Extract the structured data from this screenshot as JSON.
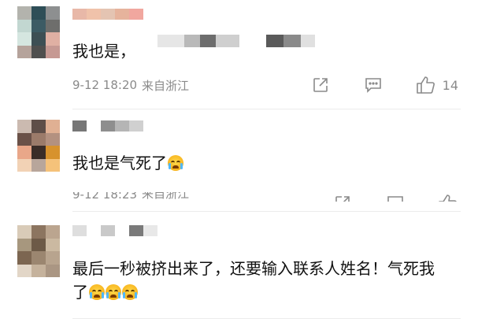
{
  "comments": [
    {
      "text_prefix": "我也是，",
      "time": "9-12 18:20",
      "location": "来自浙江",
      "likes": "14",
      "avatar_colors": [
        "#b3b3ad",
        "#2e4e57",
        "#8d8f90",
        "#c2d7d1",
        "#3c5b64",
        "#6e6e6c",
        "#d5e6e0",
        "#3d4f54",
        "#e0b0a3",
        "#b5a39b",
        "#4f4f4e",
        "#c69993"
      ],
      "name_colors": [
        "#e8b8a8",
        "#f0c2aa",
        "#e4c4b2",
        "#e6b39c",
        "#f1a79f"
      ],
      "mask_colors": [
        "#e6e6e6",
        "#b9b9b9",
        "#6d6d6d",
        "#cfcfcf",
        "#ffffff",
        "#5a5a5a",
        "#8a8a8a",
        "#e0e0e0"
      ]
    },
    {
      "text": "我也是气死了",
      "time_clipped": "9-12 18:23",
      "location_clipped": "来自浙江",
      "avatar_colors": [
        "#cbbab0",
        "#5e4e48",
        "#e0b093",
        "#6a5148",
        "#9b7b6a",
        "#b39180",
        "#e9a789",
        "#3a2d28",
        "#d7922d",
        "#f2d2b5",
        "#b8a69b",
        "#f5c27a"
      ],
      "name_colors": [
        "#777777",
        "#ffffff",
        "#8e8e8e",
        "#b5b5b5",
        "#d0d0d0"
      ]
    },
    {
      "text": "最后一秒被挤出来了，还要输入联系人姓名！气死我了",
      "avatar_colors": [
        "#d9cbb8",
        "#8c7560",
        "#bba58f",
        "#a7977e",
        "#6d5a47",
        "#cbb9a1",
        "#7c6651",
        "#9b8670",
        "#b8a48e",
        "#e2d6c7",
        "#c5b29c",
        "#aa9683"
      ],
      "name_colors": [
        "#dedede",
        "#ffffff",
        "#c9c9c9",
        "#ffffff",
        "#7a7a7a",
        "#e8e8e8"
      ]
    }
  ],
  "icons": {
    "share": "share-icon",
    "reply": "reply-icon",
    "like": "thumbs-up-icon",
    "emoji": "crying-face-emoji"
  }
}
